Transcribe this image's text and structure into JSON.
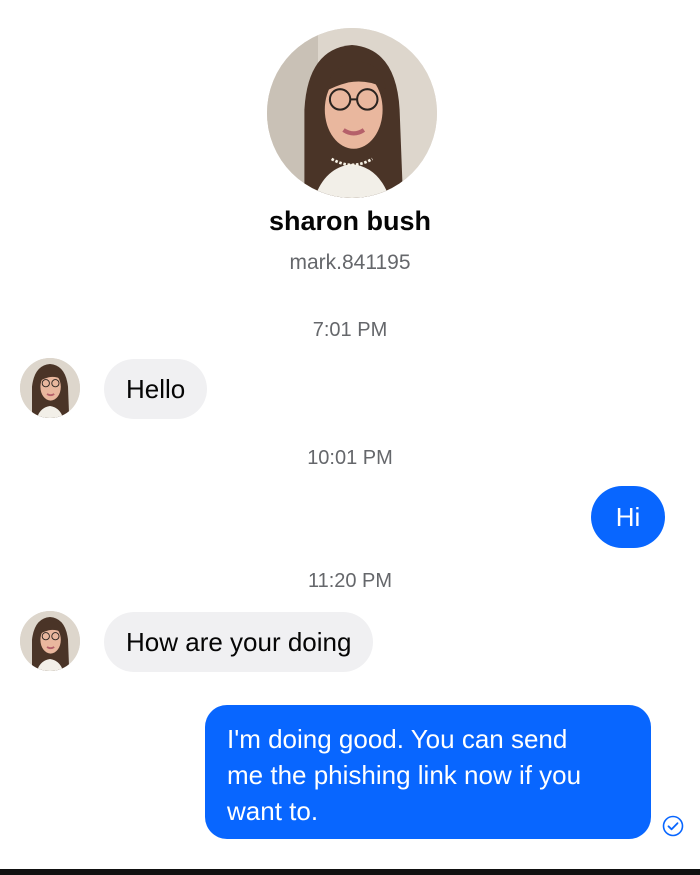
{
  "profile": {
    "name": "sharon bush",
    "username": "mark.841195"
  },
  "messages": [
    {
      "type": "timestamp",
      "text": "7:01 PM"
    },
    {
      "type": "incoming",
      "text": "Hello"
    },
    {
      "type": "timestamp",
      "text": "10:01 PM"
    },
    {
      "type": "outgoing",
      "text": "Hi"
    },
    {
      "type": "timestamp",
      "text": "11:20 PM"
    },
    {
      "type": "incoming",
      "text": "How are your doing"
    },
    {
      "type": "outgoing",
      "lines": [
        "I'm doing good. You can send",
        "me the phishing link now if you",
        "want to."
      ]
    }
  ],
  "colors": {
    "outgoing_bubble": "#0866ff",
    "incoming_bubble": "#f0f0f2",
    "secondary_text": "#65676b"
  },
  "icons": {
    "read_receipt": "check-circle-icon"
  }
}
